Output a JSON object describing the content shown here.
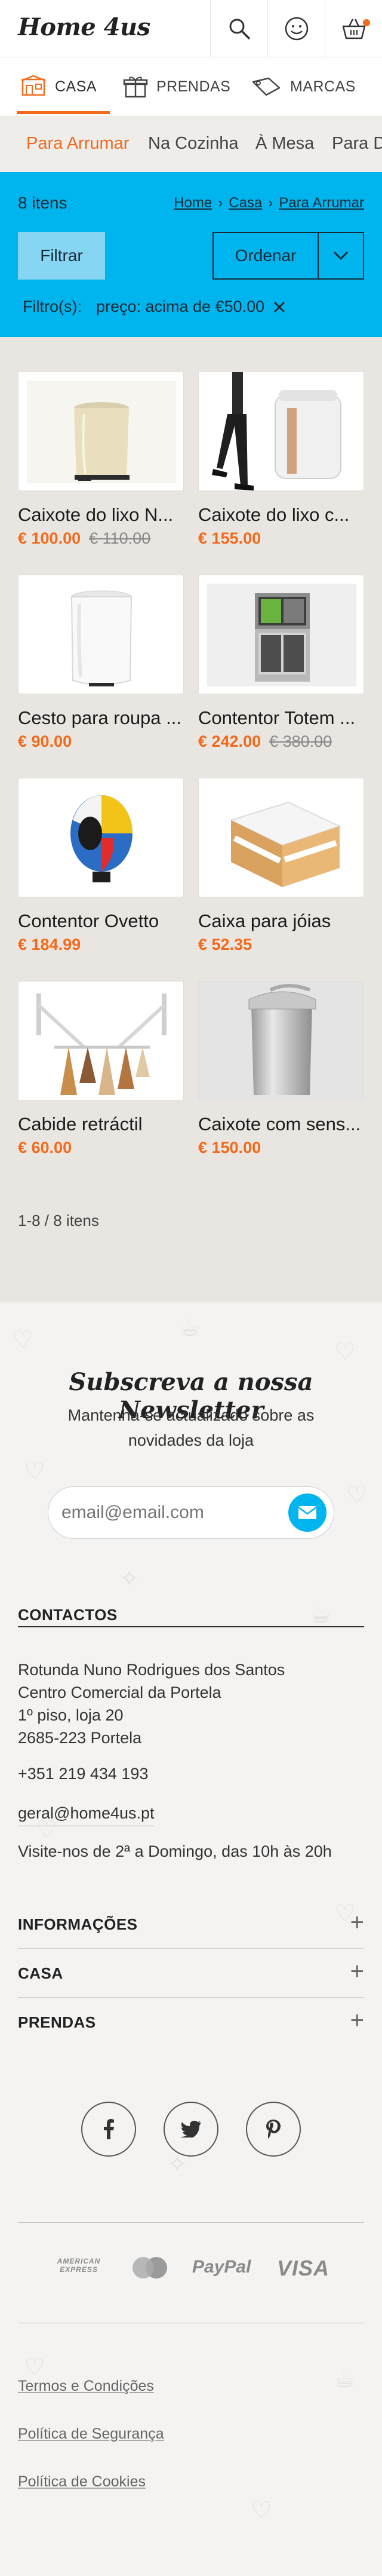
{
  "header": {
    "logo": "Home 4us",
    "icons": [
      "search-icon",
      "user-icon",
      "basket-icon"
    ]
  },
  "nav": {
    "tabs": [
      {
        "label": "CASA",
        "icon": "house-icon",
        "active": true
      },
      {
        "label": "PRENDAS",
        "icon": "gift-icon",
        "active": false
      },
      {
        "label": "MARCAS",
        "icon": "tag-icon",
        "active": false
      }
    ]
  },
  "subcategories": [
    {
      "label": "Para Arrumar",
      "active": true
    },
    {
      "label": "Na Cozinha",
      "active": false
    },
    {
      "label": "À Mesa",
      "active": false
    },
    {
      "label": "Para D",
      "active": false
    }
  ],
  "listing": {
    "count": "8 itens",
    "breadcrumb": [
      "Home",
      "Casa",
      "Para Arrumar"
    ],
    "filter_button": "Filtrar",
    "sort_button": "Ordenar",
    "filters_label": "Filtro(s):",
    "active_filter": "preço: acima de €50.00"
  },
  "products": [
    {
      "name": "Caixote do lixo N...",
      "price": "€ 100.00",
      "old_price": "€ 110.00"
    },
    {
      "name": "Caixote do lixo c...",
      "price": "€ 155.00",
      "old_price": ""
    },
    {
      "name": "Cesto para roupa ...",
      "price": "€ 90.00",
      "old_price": ""
    },
    {
      "name": "Contentor Totem ...",
      "price": "€ 242.00",
      "old_price": "€ 380.00"
    },
    {
      "name": "Contentor Ovetto",
      "price": "€ 184.99",
      "old_price": ""
    },
    {
      "name": "Caixa para jóias",
      "price": "€ 52.35",
      "old_price": ""
    },
    {
      "name": "Cabide retráctil",
      "price": "€ 60.00",
      "old_price": ""
    },
    {
      "name": "Caixote com sens...",
      "price": "€ 150.00",
      "old_price": ""
    }
  ],
  "pagination": "1-8 / 8 itens",
  "newsletter": {
    "title": "Subscreva a nossa Newsletter",
    "subtitle": "Mantenha-se actualizado sobre as novidades da loja",
    "placeholder": "email@email.com"
  },
  "contacts": {
    "title": "CONTACTOS",
    "address": [
      "Rotunda Nuno Rodrigues dos Santos",
      "Centro Comercial da Portela",
      "1º piso, loja 20",
      "2685-223 Portela"
    ],
    "phone": "+351 219 434 193",
    "email": "geral@home4us.pt",
    "hours": "Visite-nos de 2ª a Domingo, das 10h às 20h"
  },
  "accordion": [
    "INFORMAÇÕES",
    "CASA",
    "PRENDAS"
  ],
  "social": [
    "facebook-icon",
    "twitter-icon",
    "pinterest-icon"
  ],
  "payments": {
    "amex": "AMERICAN EXPRESS",
    "paypal": "PayPal",
    "visa": "VISA"
  },
  "footer_links": [
    "Termos e Condições",
    "Política de Segurança",
    "Política de Cookies"
  ],
  "colors": {
    "accent": "#f26a1b",
    "blue": "#00b5ee",
    "grid_bg": "#e9e6e2"
  }
}
